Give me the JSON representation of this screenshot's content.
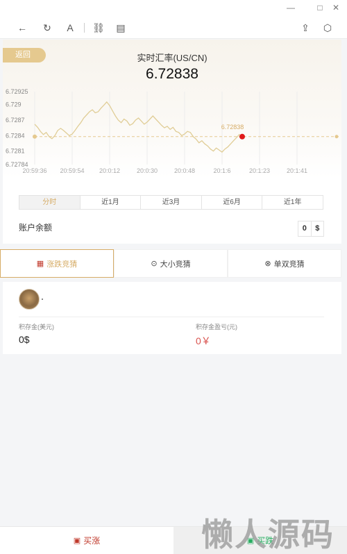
{
  "window": {
    "minimize": "—",
    "maximize": "□",
    "close": "✕"
  },
  "toolbar": {
    "back_icon": "←",
    "refresh_icon": "↻",
    "text_icon": "A",
    "link_icon": "⛓",
    "reader_icon": "▤",
    "share_icon": "⇪",
    "box_icon": "⬡"
  },
  "header": {
    "back_label": "返回",
    "rate_label": "实时汇率(US/CN)",
    "rate_value": "6.72838"
  },
  "chart_data": {
    "type": "line",
    "title": "实时汇率(US/CN)",
    "y_ticks": [
      "6.72925",
      "6.729",
      "6.7287",
      "6.7284",
      "6.7281",
      "6.72784"
    ],
    "x_ticks": [
      "20:59:36",
      "20:59:54",
      "20:0:12",
      "20:0:30",
      "20:0:48",
      "20:1:6",
      "20:1:23",
      "20:1:41"
    ],
    "ylim": [
      6.72784,
      6.72925
    ],
    "current_value": 6.72838,
    "current_label": "6.72838",
    "colors": {
      "line": "#e0cd96",
      "dashed": "#e5c98f",
      "dot": "#e01a1a",
      "label": "#d6ac66"
    },
    "series": [
      {
        "values": [
          6.72862,
          6.72856,
          6.72848,
          6.72842,
          6.72846,
          6.72838,
          6.72834,
          6.7284,
          6.7285,
          6.72854,
          6.7285,
          6.72845,
          6.7284,
          6.72843,
          6.7285,
          6.72858,
          6.72865,
          6.72874,
          6.7288,
          6.72886,
          6.7289,
          6.72884,
          6.72886,
          6.72893,
          6.72899,
          6.72905,
          6.72898,
          6.72888,
          6.72878,
          6.7287,
          6.72865,
          6.72872,
          6.72868,
          6.7286,
          6.72863,
          6.7287,
          6.72874,
          6.72868,
          6.72862,
          6.72866,
          6.72872,
          6.72878,
          6.72872,
          6.72866,
          6.7286,
          6.72855,
          6.72858,
          6.72852,
          6.72856,
          6.72848,
          6.72846,
          6.7284,
          6.72843,
          6.72848,
          6.72846,
          6.72838,
          6.72833,
          6.72826,
          6.7283,
          6.72824,
          6.7282,
          6.72814,
          6.7281,
          6.72816,
          6.72812,
          6.72808,
          6.72814,
          6.72818,
          6.72824,
          6.7283,
          6.72836,
          6.72842,
          6.72838
        ]
      }
    ]
  },
  "period_tabs": [
    "分时",
    "近1月",
    "近3月",
    "近6月",
    "近1年"
  ],
  "balance": {
    "label": "账户余额",
    "value": "0",
    "currency": "$"
  },
  "mode_tabs": [
    {
      "icon": "▦",
      "label": "涨跌竞猜"
    },
    {
      "icon": "⊙",
      "label": "大小竞猜"
    },
    {
      "icon": "⊗",
      "label": "单双竞猜"
    }
  ],
  "user": {
    "deposit_label": "积存金(美元)",
    "deposit_value": "0$",
    "profit_label": "积存金盈亏(元)",
    "profit_value": "0￥"
  },
  "bottom": {
    "buy_up_icon": "▣",
    "buy_up": "买涨",
    "buy_down_icon": "▣",
    "buy_down": "买跌"
  },
  "watermark": "懒人源码"
}
